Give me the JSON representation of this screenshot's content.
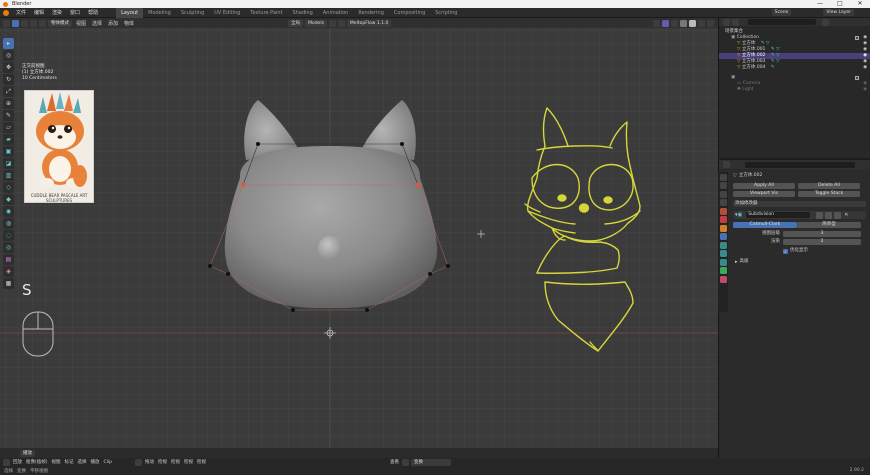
{
  "window": {
    "title": "Blender",
    "controls": [
      "—",
      "□",
      "✕"
    ]
  },
  "menubar": {
    "menus": [
      "文件",
      "编辑",
      "渲染",
      "窗口",
      "帮助"
    ],
    "workspace_tabs": [
      "Layout",
      "Modeling",
      "Sculpting",
      "UV Editing",
      "Texture Paint",
      "Shading",
      "Animation",
      "Rendering",
      "Compositing",
      "Scripting"
    ],
    "active_workspace": "Layout",
    "scene_label": "Scene",
    "view_layer_label": "View Layer"
  },
  "viewport_header": {
    "mode": "物体模式",
    "menus": [
      "视图",
      "选择",
      "添加",
      "物体"
    ],
    "shading_label": "Models",
    "snapping_label": "MeltopFlow 1.1.0",
    "orientation": "全局"
  },
  "viewport_info": {
    "view_name": "正交前视图",
    "object_line": "(1) 立方体.002",
    "extra_line": "10 Centimeters"
  },
  "reference_image": {
    "caption": "CUDDLE BEAR PASCALE ART SCULPTURES"
  },
  "key_overlay": "S",
  "timeline": {
    "label": "播放"
  },
  "status_bar": {
    "items": [
      "回放",
      "抠像(插帧)",
      "视图",
      "标记",
      "选择",
      "播放",
      "Clip",
      "◎",
      "拖动",
      "检视",
      "检视",
      "检视",
      "检视",
      "查看",
      "变换",
      "检视",
      "选择",
      "变换"
    ],
    "right_items": [
      "平移视图",
      "2.90.2"
    ]
  },
  "outliner": {
    "header": "场景集合",
    "search_placeholder": "",
    "rows": [
      {
        "label": "Collection",
        "indent": 0,
        "selected": false,
        "icon_color": "#a0a0a0"
      },
      {
        "label": "立方体",
        "indent": 1,
        "selected": false,
        "icon_color": "#e8a33a"
      },
      {
        "label": "立方体.001",
        "indent": 1,
        "selected": false,
        "icon_color": "#e8a33a"
      },
      {
        "label": "立方体.002",
        "indent": 1,
        "selected": true,
        "icon_color": "#e8a33a"
      },
      {
        "label": "立方体.003",
        "indent": 1,
        "selected": false,
        "icon_color": "#e8a33a"
      },
      {
        "label": "立方体.004",
        "indent": 1,
        "selected": false,
        "icon_color": "#e8a33a"
      },
      {
        "label": "Camera",
        "indent": 1,
        "selected": false,
        "icon_color": "#7a7a7a"
      },
      {
        "label": "Light",
        "indent": 1,
        "selected": false,
        "icon_color": "#7a7a7a"
      }
    ]
  },
  "properties": {
    "object_name": "立方体.002",
    "apply_all": "Apply All",
    "delete_all": "Delete All",
    "viewport_vis": "Viewport Vis",
    "toggle_stack": "Toggle Stack",
    "add_modifier": "添加修改器",
    "modifier_name": "Subdivision",
    "catmull_clark": "Catmull-Clark",
    "simple": "简单型",
    "levels_viewport_label": "视图层级",
    "levels_viewport_value": "3",
    "levels_render_label": "渲染",
    "levels_render_value": "2",
    "optimal_display": "优化显示",
    "advanced": "高级"
  },
  "colors": {
    "accent_blue": "#4772b3",
    "accent_purple": "#6b57b4",
    "selection_yellow": "#d6d63a",
    "vertex_orange": "#e8553a"
  }
}
